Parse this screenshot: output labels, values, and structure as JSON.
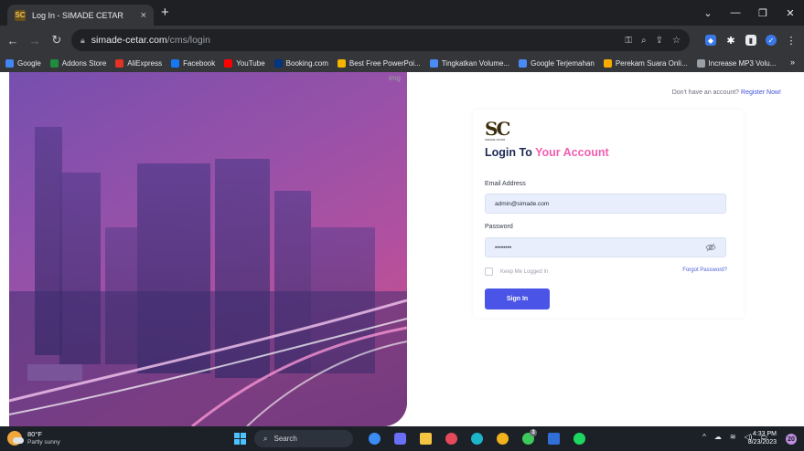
{
  "browser": {
    "tab_title": "Log In - SIMADE CETAR",
    "tab_favicon": "SC",
    "close_glyph": "×",
    "new_tab_glyph": "+",
    "url_host": "simade-cetar.com",
    "url_path": "/cms/login",
    "bookmarks": [
      {
        "label": "Google",
        "color": "#4285f4"
      },
      {
        "label": "Addons Store",
        "color": "#1e8e3e"
      },
      {
        "label": "AliExpress",
        "color": "#e43225"
      },
      {
        "label": "Facebook",
        "color": "#1877f2"
      },
      {
        "label": "YouTube",
        "color": "#ff0000"
      },
      {
        "label": "Booking.com",
        "color": "#003580"
      },
      {
        "label": "Best Free PowerPoi...",
        "color": "#f4b400"
      },
      {
        "label": "Tingkatkan Volume...",
        "color": "#4a8af4"
      },
      {
        "label": "Google Terjemahan",
        "color": "#4a8af4"
      },
      {
        "label": "Perekam Suara Onli...",
        "color": "#f9ab00"
      },
      {
        "label": "Increase MP3 Volu...",
        "color": "#9aa0a6"
      }
    ],
    "bookmarks_more": "»"
  },
  "page": {
    "image_alt": "img",
    "register_prompt": "Don't have an account?",
    "register_link": "Register Now!",
    "logo_text": "SC",
    "logo_subtitle": "SIMADE CETAR",
    "title_part1": "Login To ",
    "title_part2": "Your Account",
    "email_label": "Email Address",
    "email_value": "admin@simade.com",
    "password_label": "Password",
    "password_value": "••••••••",
    "remember_label": "Keep Me Logged In",
    "forgot_link": "Forgot Password?",
    "signin_button": "Sign In",
    "accent_color": "#f25fb0",
    "button_color": "#4a55e8"
  },
  "taskbar": {
    "temperature": "80°F",
    "weather": "Partly sunny",
    "search_placeholder": "Search",
    "time": "4:33 PM",
    "date": "8/23/2023",
    "notification_count": "20",
    "badge_count": "3"
  }
}
